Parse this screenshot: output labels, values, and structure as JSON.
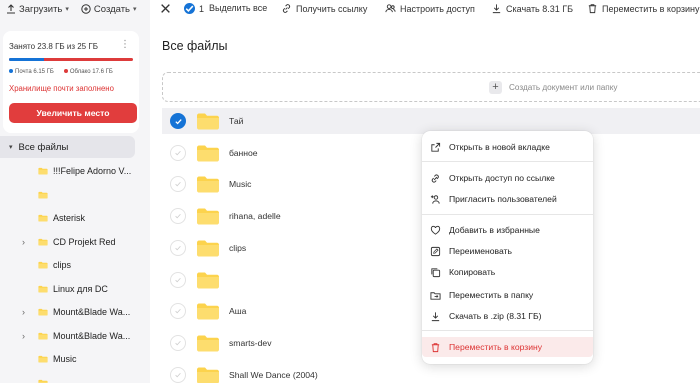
{
  "sidebar": {
    "upload_label": "Загрузить",
    "create_label": "Создать",
    "storage": {
      "used_text": "Занято 23.8 ГБ из 25 ГБ",
      "mail_label": "Почта 6.15 ГБ",
      "cloud_label": "Облако 17.6 ГБ",
      "mail_fraction": 0.26,
      "cloud_fraction": 0.7,
      "mail_color": "#1573d6",
      "cloud_color": "#dd3b3b",
      "warning": "Хранилище почти заполнено",
      "upgrade_label": "Увеличить место"
    },
    "tree_root": "Все файлы",
    "tree": [
      {
        "label": "!!!Felipe Adorno V...",
        "expandable": false
      },
      {
        "label": "",
        "expandable": false
      },
      {
        "label": "Asterisk",
        "expandable": false
      },
      {
        "label": "CD Projekt Red",
        "expandable": true
      },
      {
        "label": "clips",
        "expandable": false
      },
      {
        "label": "Linux для DC",
        "expandable": false
      },
      {
        "label": "Mount&Blade Wa...",
        "expandable": true
      },
      {
        "label": "Mount&Blade Wa...",
        "expandable": true
      },
      {
        "label": "Music",
        "expandable": false
      },
      {
        "label": "",
        "expandable": false
      }
    ]
  },
  "toolbar": {
    "close_icon": "close-icon",
    "selected_count": "1",
    "select_all": "Выделить все",
    "get_link": "Получить ссылку",
    "access": "Настроить доступ",
    "download": "Скачать 8.31 ГБ",
    "move_to_trash": "Переместить в корзину"
  },
  "main": {
    "title": "Все файлы",
    "create_doc": "Создать документ или папку",
    "files": [
      {
        "name": "Тай",
        "selected": true
      },
      {
        "name": "банное",
        "selected": false
      },
      {
        "name": "Music",
        "selected": false
      },
      {
        "name": "rihana, adelle",
        "selected": false
      },
      {
        "name": "clips",
        "selected": false
      },
      {
        "name": "",
        "selected": false
      },
      {
        "name": "Аша",
        "selected": false
      },
      {
        "name": "smarts-dev",
        "selected": false
      },
      {
        "name": "Shall We Dance (2004)",
        "selected": false
      }
    ]
  },
  "context_menu": {
    "items": [
      {
        "label": "Открыть в новой вкладке",
        "icon": "open-external-icon"
      },
      {
        "label": "Открыть доступ по ссылке",
        "icon": "link-icon"
      },
      {
        "label": "Пригласить пользователей",
        "icon": "add-user-icon"
      },
      {
        "label": "Добавить в избранные",
        "icon": "heart-icon"
      },
      {
        "label": "Переименовать",
        "icon": "rename-icon"
      },
      {
        "label": "Копировать",
        "icon": "copy-icon"
      },
      {
        "label": "Переместить в папку",
        "icon": "move-folder-icon"
      },
      {
        "label": "Скачать в .zip (8.31 ГБ)",
        "icon": "download-icon"
      },
      {
        "label": "Переместить в корзину",
        "icon": "trash-icon"
      }
    ]
  },
  "colors": {
    "accent": "#1573d6",
    "danger": "#e13d3d",
    "folder": "#fcd34d"
  }
}
